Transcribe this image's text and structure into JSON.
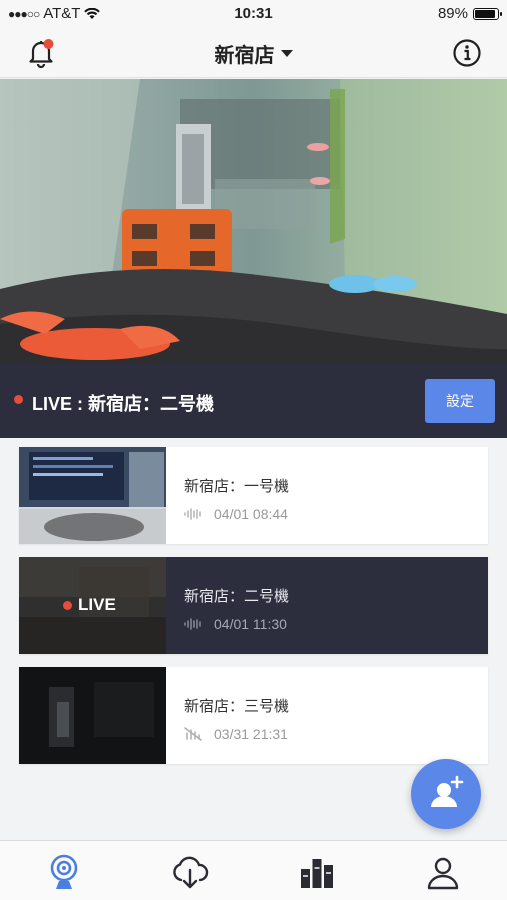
{
  "status_bar": {
    "carrier": "AT&T",
    "time": "10:31",
    "battery": "89%",
    "battery_level": 0.89
  },
  "header": {
    "title": "新宿店",
    "bell_has_notification": true
  },
  "live": {
    "title": "LIVE : 新宿店：二号機",
    "settings_label": "設定"
  },
  "devices": [
    {
      "name": "新宿店：一号機",
      "datetime": "04/01 08:44",
      "status_icon": "sound-wave-icon",
      "live": false
    },
    {
      "name": "新宿店：二号機",
      "datetime": "04/01 11:30",
      "status_icon": "sound-wave-icon",
      "live": true,
      "live_label": "LIVE"
    },
    {
      "name": "新宿店：三号機",
      "datetime": "03/31 21:31",
      "status_icon": "muted-signal-icon",
      "live": false
    }
  ],
  "colors": {
    "accent": "#5b87e8",
    "dark_panel": "#2c2e3e",
    "live_red": "#e74c3c",
    "notification_red": "#e74c3c"
  },
  "tabs": [
    {
      "name": "camera-tab",
      "icon": "webcam-icon",
      "active": true
    },
    {
      "name": "download-tab",
      "icon": "cloud-download-icon",
      "active": false
    },
    {
      "name": "stats-tab",
      "icon": "bar-chart-icon",
      "active": false
    },
    {
      "name": "profile-tab",
      "icon": "user-icon",
      "active": false
    }
  ]
}
